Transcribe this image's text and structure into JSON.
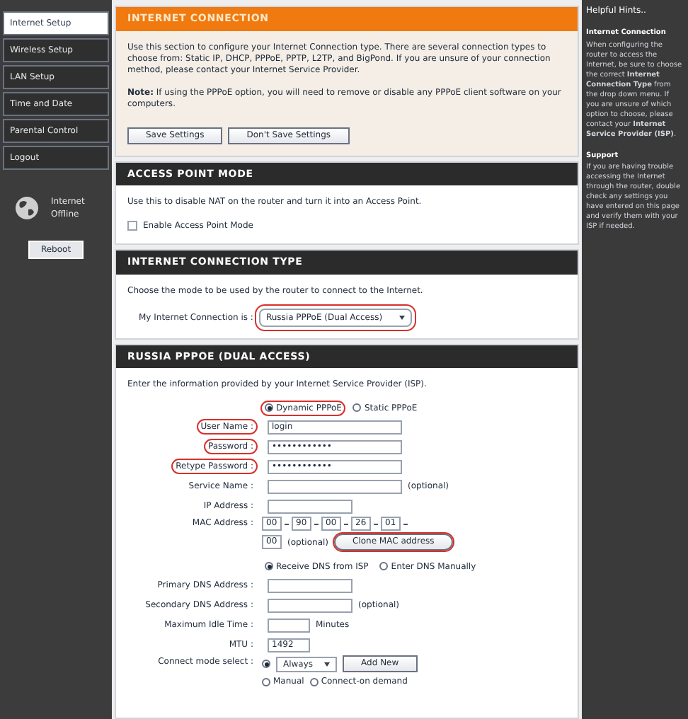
{
  "sidebar": {
    "items": [
      {
        "label": "Internet Setup",
        "selected": true
      },
      {
        "label": "Wireless Setup",
        "selected": false
      },
      {
        "label": "LAN Setup",
        "selected": false
      },
      {
        "label": "Time and Date",
        "selected": false
      },
      {
        "label": "Parental Control",
        "selected": false
      },
      {
        "label": "Logout",
        "selected": false
      }
    ],
    "status": "Internet Offline",
    "reboot": "Reboot"
  },
  "internet_connection": {
    "title": "INTERNET CONNECTION",
    "text": "Use this section to configure your Internet Connection type. There are several connection types to choose from: Static IP, DHCP, PPPoE, PPTP, L2TP, and BigPond. If you are unsure of your connection method, please contact your Internet Service Provider.",
    "note": "**Note:** If using the PPPoE option, you will need to remove or disable any PPPoE client software on your computers.",
    "buttons": [
      "Save Settings",
      "Don't Save Settings"
    ]
  },
  "access_point_mode": {
    "title": "ACCESS POINT MODE",
    "text": "Use this to disable NAT on the router and turn it into an Access Point.",
    "checkbox": {
      "label": "Enable Access Point Mode",
      "checked": false
    }
  },
  "connection_type": {
    "title": "INTERNET CONNECTION TYPE",
    "text": "Choose the mode to be used by the router to connect to the Internet.",
    "label": "My Internet Connection is :",
    "value": "Russia PPPoE (Dual Access)",
    "highlighted": true
  },
  "pppoe": {
    "title": "RUSSIA PPPOE (DUAL ACCESS)",
    "text": "Enter the information provided by your Internet Service Provider (ISP).",
    "fields": [
      {
        "kind": "radios",
        "options": [
          {
            "label": "Dynamic PPPoE",
            "selected": true,
            "highlighted": true
          },
          {
            "label": "Static PPPoE",
            "selected": false,
            "highlighted": false
          }
        ]
      },
      {
        "kind": "input",
        "label": "User Name :",
        "value": "login",
        "highlighted": true
      },
      {
        "kind": "input",
        "label": "Password :",
        "value": "••••••••••••",
        "highlighted": true
      },
      {
        "kind": "input",
        "label": "Retype Password :",
        "value": "••••••••••••",
        "highlighted": true
      },
      {
        "kind": "input",
        "label": "Service Name :",
        "hint": "(optional)",
        "highlighted": false
      },
      {
        "kind": "input_medium",
        "label": "IP Address :",
        "highlighted": false
      },
      {
        "kind": "mac",
        "label": "MAC Address :",
        "parts": [
          "00",
          "90",
          "00",
          "26",
          "01",
          "00"
        ],
        "hint": "(optional)",
        "button": "Clone MAC address",
        "highlighted": true
      },
      {
        "kind": "radios",
        "options": [
          {
            "label": "Receive DNS from ISP",
            "selected": true,
            "highlighted": false
          },
          {
            "label": "Enter DNS Manually",
            "selected": false,
            "highlighted": false
          }
        ]
      },
      {
        "kind": "input_medium",
        "label": "Primary DNS Address :",
        "highlighted": false
      },
      {
        "kind": "input_medium",
        "label": "Secondary DNS Address :",
        "hint": "(optional)",
        "highlighted": false
      },
      {
        "kind": "input_short",
        "label": "Maximum Idle Time :",
        "hint": "Minutes",
        "highlighted": false
      },
      {
        "kind": "input_short",
        "label": "MTU :",
        "value": "1492",
        "highlighted": false
      },
      {
        "kind": "connect",
        "label": "Connect mode select :",
        "selected": true,
        "select": "Always",
        "button": "Add New",
        "options": [
          {
            "label": "Manual",
            "selected": false
          },
          {
            "label": "Connect-on demand",
            "selected": false
          }
        ]
      }
    ]
  },
  "help": {
    "title": "Helpful Hints..",
    "sections": [
      {
        "heading": "Internet Connection",
        "text": "When configuring the router to access the Internet, be sure to choose the correct **Internet Connection Type** from the drop down menu. If you are unsure of which option to choose, please contact your **Internet Service Provider (ISP)**."
      },
      {
        "heading": "Support",
        "text": "If you are having trouble accessing the Internet through the router, double check any settings you have entered on this page and verify them with your ISP if needed."
      }
    ]
  }
}
